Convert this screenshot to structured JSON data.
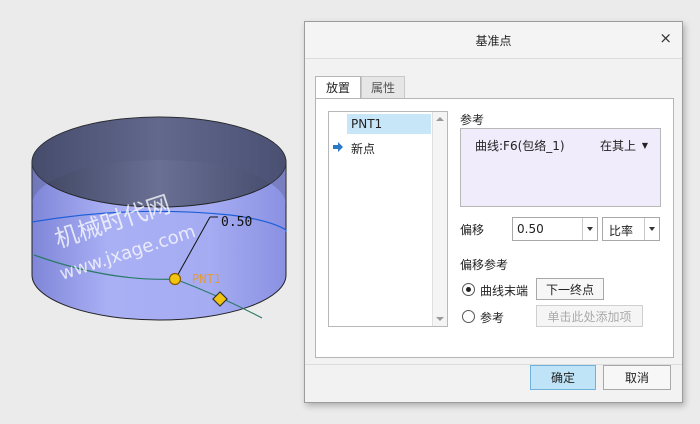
{
  "viewport": {
    "point_label": "PNT1",
    "dimension": "0.50",
    "watermark": "机械时代网",
    "watermark_url": "www.jxage.com"
  },
  "dialog": {
    "title": "基准点",
    "close_glyph": "×",
    "tabs": [
      {
        "label": "放置",
        "active": true
      },
      {
        "label": "属性",
        "active": false
      }
    ],
    "list": {
      "items": [
        {
          "label": "PNT1",
          "selected": true
        },
        {
          "label": "新点",
          "selected": false
        }
      ]
    },
    "reference": {
      "label": "参考",
      "item": "曲线:F6(包络_1)",
      "mode": "在其上",
      "mode_arrow": "▼"
    },
    "offset": {
      "label": "偏移",
      "value": "0.50",
      "type": "比率"
    },
    "offset_ref": {
      "label": "偏移参考",
      "option_end": "曲线末端",
      "next_end_button": "下一终点",
      "option_ref": "参考",
      "add_placeholder": "单击此处添加项"
    },
    "buttons": {
      "ok": "确定",
      "cancel": "取消"
    }
  },
  "colors": {
    "cylinder_side": "#9aa2ee",
    "cylinder_top": "#4c5373",
    "selection": "#c7e6f8",
    "ok_button": "#bfe3f7",
    "reference_box": "#f0ecfb",
    "curve": "#1f5fd6",
    "point": "#f1c40f",
    "point_label": "#e59a3a"
  }
}
